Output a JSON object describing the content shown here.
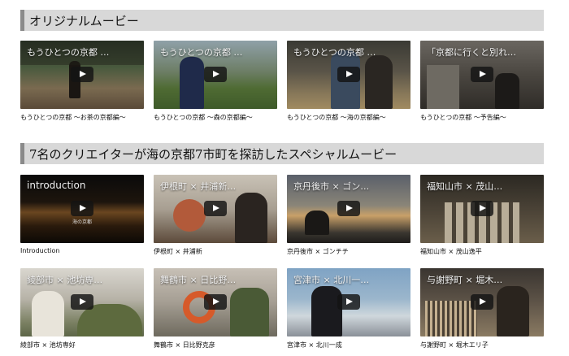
{
  "sections": [
    {
      "title": "オリジナルムービー",
      "videos": [
        {
          "thumb_title": "もうひとつの京都 …",
          "caption": "もうひとつの京都 〜お茶の京都編〜"
        },
        {
          "thumb_title": "もうひとつの京都 …",
          "caption": "もうひとつの京都 〜森の京都編〜"
        },
        {
          "thumb_title": "もうひとつの京都 …",
          "caption": "もうひとつの京都 〜海の京都編〜"
        },
        {
          "thumb_title": "「京都に行くと別れ…",
          "caption": "もうひとつの京都 〜予告編〜"
        }
      ]
    },
    {
      "title": "7名のクリエイターが海の京都7市町を探訪したスペシャルムービー",
      "videos": [
        {
          "thumb_title": "introduction",
          "caption": "Introduction",
          "watermark": "海の京都"
        },
        {
          "thumb_title": "伊根町 × 井浦新…",
          "caption": "伊根町 × 井浦新"
        },
        {
          "thumb_title": "京丹後市 × ゴン…",
          "caption": "京丹後市 × ゴンチチ"
        },
        {
          "thumb_title": "福知山市 × 茂山…",
          "caption": "福知山市 × 茂山逸平"
        },
        {
          "thumb_title": "綾部市 × 池坊専…",
          "caption": "綾部市 × 池坊専好"
        },
        {
          "thumb_title": "舞鶴市 × 日比野…",
          "caption": "舞鶴市 × 日比野克彦"
        },
        {
          "thumb_title": "宮津市 × 北川一…",
          "caption": "宮津市 × 北川一成"
        },
        {
          "thumb_title": "与謝野町 × 堀木…",
          "caption": "与謝野町 × 堀木エリ子"
        }
      ]
    }
  ],
  "icons": {
    "play": "play-icon"
  },
  "colors": {
    "header_bg": "#d8d8d8",
    "header_bar": "#8a8a8a"
  }
}
